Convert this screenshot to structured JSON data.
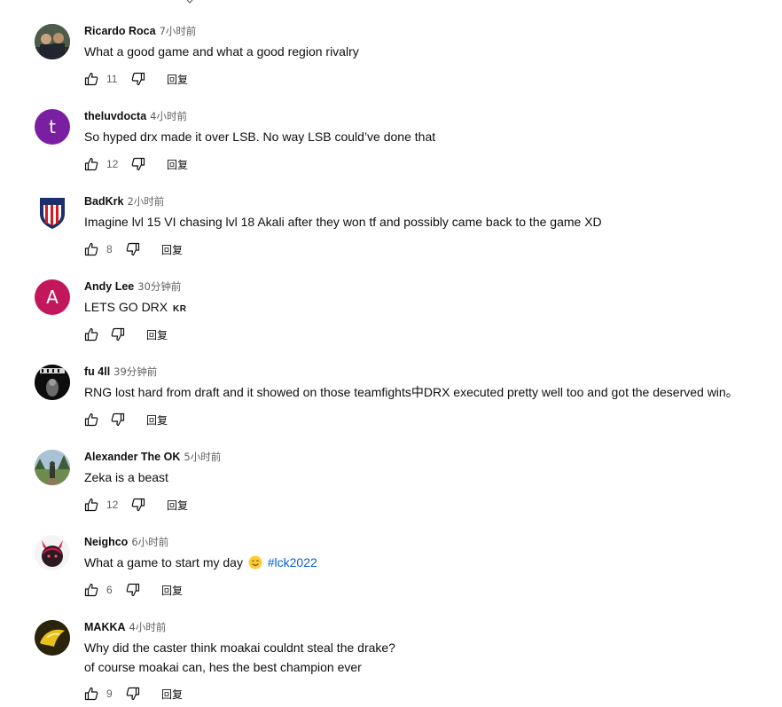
{
  "reply_label": "回复",
  "comments": [
    {
      "author": "Ricardo Roca",
      "time": "7小时前",
      "text": "What a good game and what a good region rivalry",
      "likes": "11"
    },
    {
      "author": "theluvdocta",
      "time": "4小时前",
      "text": "So hyped drx made it over LSB. No way LSB could’ve done that",
      "likes": "12",
      "avatar_letter": "t"
    },
    {
      "author": "BadKrk",
      "time": "2小时前",
      "text": "Imagine lvl 15 VI chasing lvl 18 Akali after they won tf and possibly came back to the game XD",
      "likes": "8"
    },
    {
      "author": "Andy Lee",
      "time": "30分钟前",
      "text": "LETS GO DRX",
      "badge": "KR",
      "likes": "",
      "avatar_letter": "A"
    },
    {
      "author": "fu 4ll",
      "time": "39分钟前",
      "text": "RNG lost hard from draft and it showed on those teamfights中DRX executed pretty well too and got the deserved win。",
      "likes": ""
    },
    {
      "author": "Alexander The OK",
      "time": "5小时前",
      "text": "Zeka is a beast",
      "likes": "12"
    },
    {
      "author": "Neighco",
      "time": "6小时前",
      "text": "What a game to start my day",
      "hashtag": "#lck2022",
      "likes": "6"
    },
    {
      "author": "MAKKA",
      "time": "4小时前",
      "text_line1": "Why did the caster think moakai couldnt steal the drake?",
      "text_line2": "of course moakai can, hes the best champion ever",
      "likes": "9"
    }
  ],
  "colors": {
    "avatar_t": "#7b1fa2",
    "avatar_a": "#c2185b",
    "hashtag": "#065fd4",
    "secondary": "#606060"
  }
}
